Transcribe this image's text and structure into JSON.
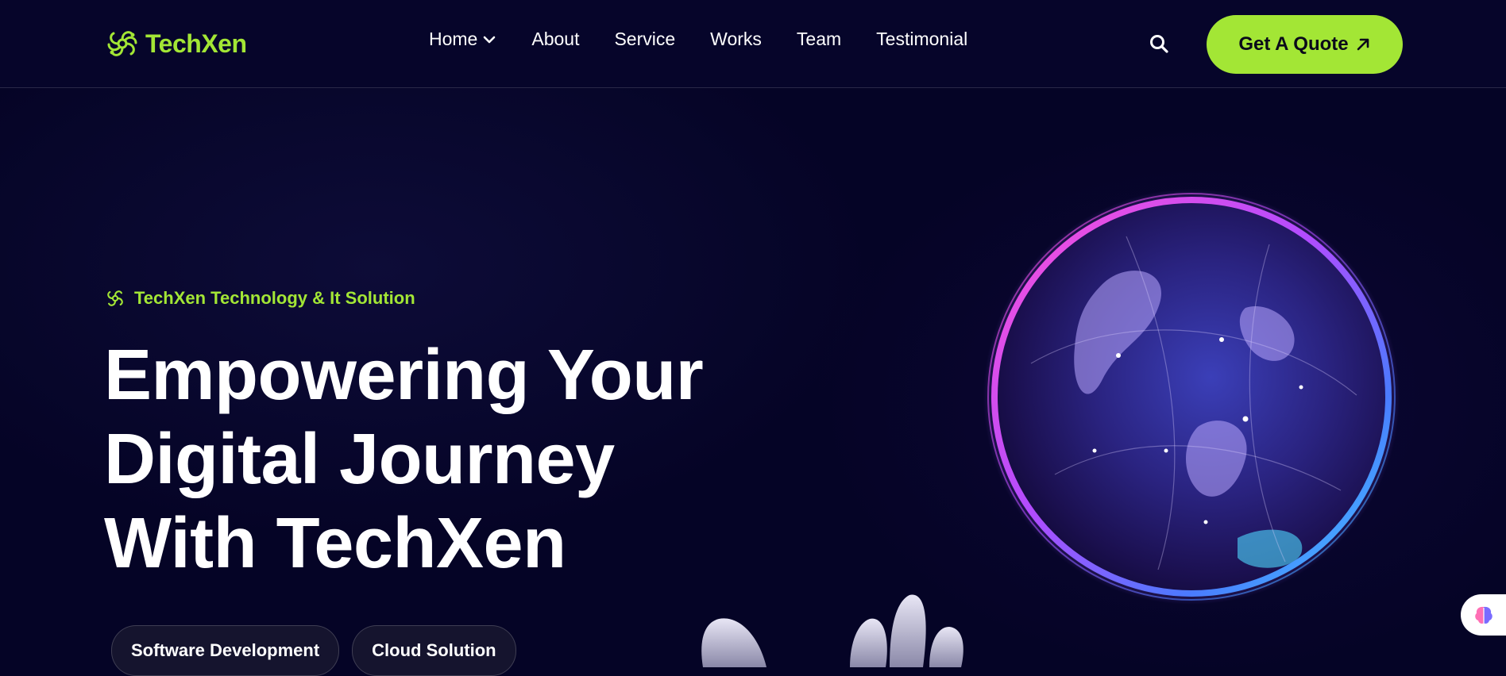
{
  "brand": {
    "name": "TechXen",
    "accent_color": "#a3e635",
    "logo_icon": "circuit-flower-icon"
  },
  "nav": {
    "items": [
      {
        "label": "Home",
        "has_dropdown": true
      },
      {
        "label": "About"
      },
      {
        "label": "Service"
      },
      {
        "label": "Works"
      },
      {
        "label": "Team"
      },
      {
        "label": "Testimonial"
      }
    ]
  },
  "header": {
    "search_icon": "search-icon",
    "quote_label": "Get A Quote",
    "quote_icon": "arrow-up-right-icon"
  },
  "hero": {
    "tagline": "TechXen Technology & It Solution",
    "title_lines": [
      "Empowering Your",
      "Digital Journey",
      "With TechXen"
    ],
    "chips": [
      "Software Development",
      "Cloud Solution"
    ],
    "image": "glowing-globe-with-robot-hand"
  },
  "widget": {
    "icon": "brain-icon"
  },
  "colors": {
    "background": "#050426",
    "accent": "#a3e635",
    "text": "#ffffff"
  }
}
